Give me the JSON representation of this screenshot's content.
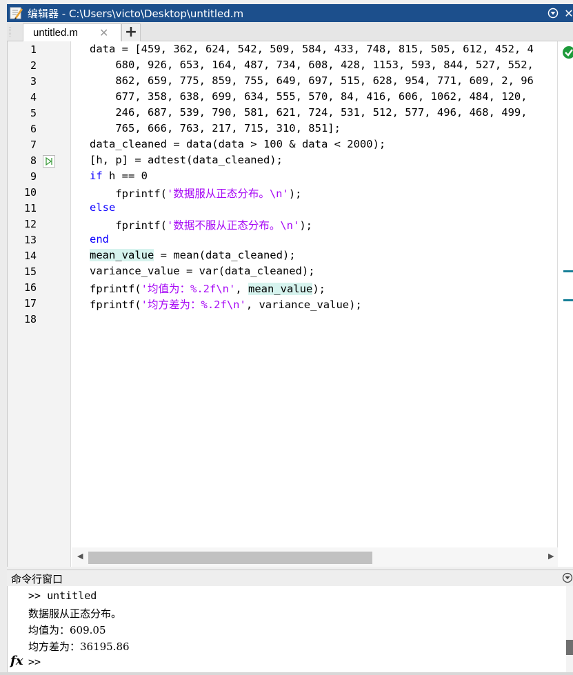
{
  "window": {
    "title": "编辑器 - C:\\Users\\victo\\Desktop\\untitled.m"
  },
  "tabs": {
    "active": "untitled.m",
    "close_symbol": "✕",
    "add_symbol": "+"
  },
  "editor": {
    "line_numbers": [
      "1",
      "2",
      "3",
      "4",
      "5",
      "6",
      "7",
      "8",
      "9",
      "10",
      "11",
      "12",
      "13",
      "14",
      "15",
      "16",
      "17",
      "18"
    ],
    "lines": [
      "data = [459, 362, 624, 542, 509, 584, 433, 748, 815, 505, 612, 452, 4",
      "    680, 926, 653, 164, 487, 734, 608, 428, 1153, 593, 844, 527, 552,",
      "    862, 659, 775, 859, 755, 649, 697, 515, 628, 954, 771, 609, 2, 96",
      "    677, 358, 638, 699, 634, 555, 570, 84, 416, 606, 1062, 484, 120,",
      "    246, 687, 539, 790, 581, 621, 724, 531, 512, 577, 496, 468, 499,",
      "    765, 666, 763, 217, 715, 310, 851];",
      "data_cleaned = data(data > 100 & data < 2000);",
      "[h, p] = adtest(data_cleaned);",
      "if",
      " h == 0",
      "    fprintf(",
      "'数据服从正态分布。\\n'",
      ");",
      "else",
      "    fprintf(",
      "'数据不服从正态分布。\\n'",
      ");",
      "end",
      "mean_value",
      " = mean(data_cleaned);",
      "variance_value = var(data_cleaned);",
      "fprintf(",
      "'均值为：%.2f\\n'",
      ", ",
      "mean_value",
      ");",
      "fprintf(",
      "'均方差为：%.2f\\n'",
      ", variance_value);"
    ]
  },
  "command_window": {
    "title": "命令行窗口",
    "lines": [
      ">> untitled",
      "数据服从正态分布。",
      "均值为：609.05",
      "均方差为：36195.86"
    ],
    "prompt": ">>",
    "fx": "fx"
  },
  "colors": {
    "titlebar": "#1c4f8c",
    "keyword": "#0e00ff",
    "string": "#a709f5",
    "highlight": "#d6f3ee",
    "ok": "#1d9a3a"
  }
}
